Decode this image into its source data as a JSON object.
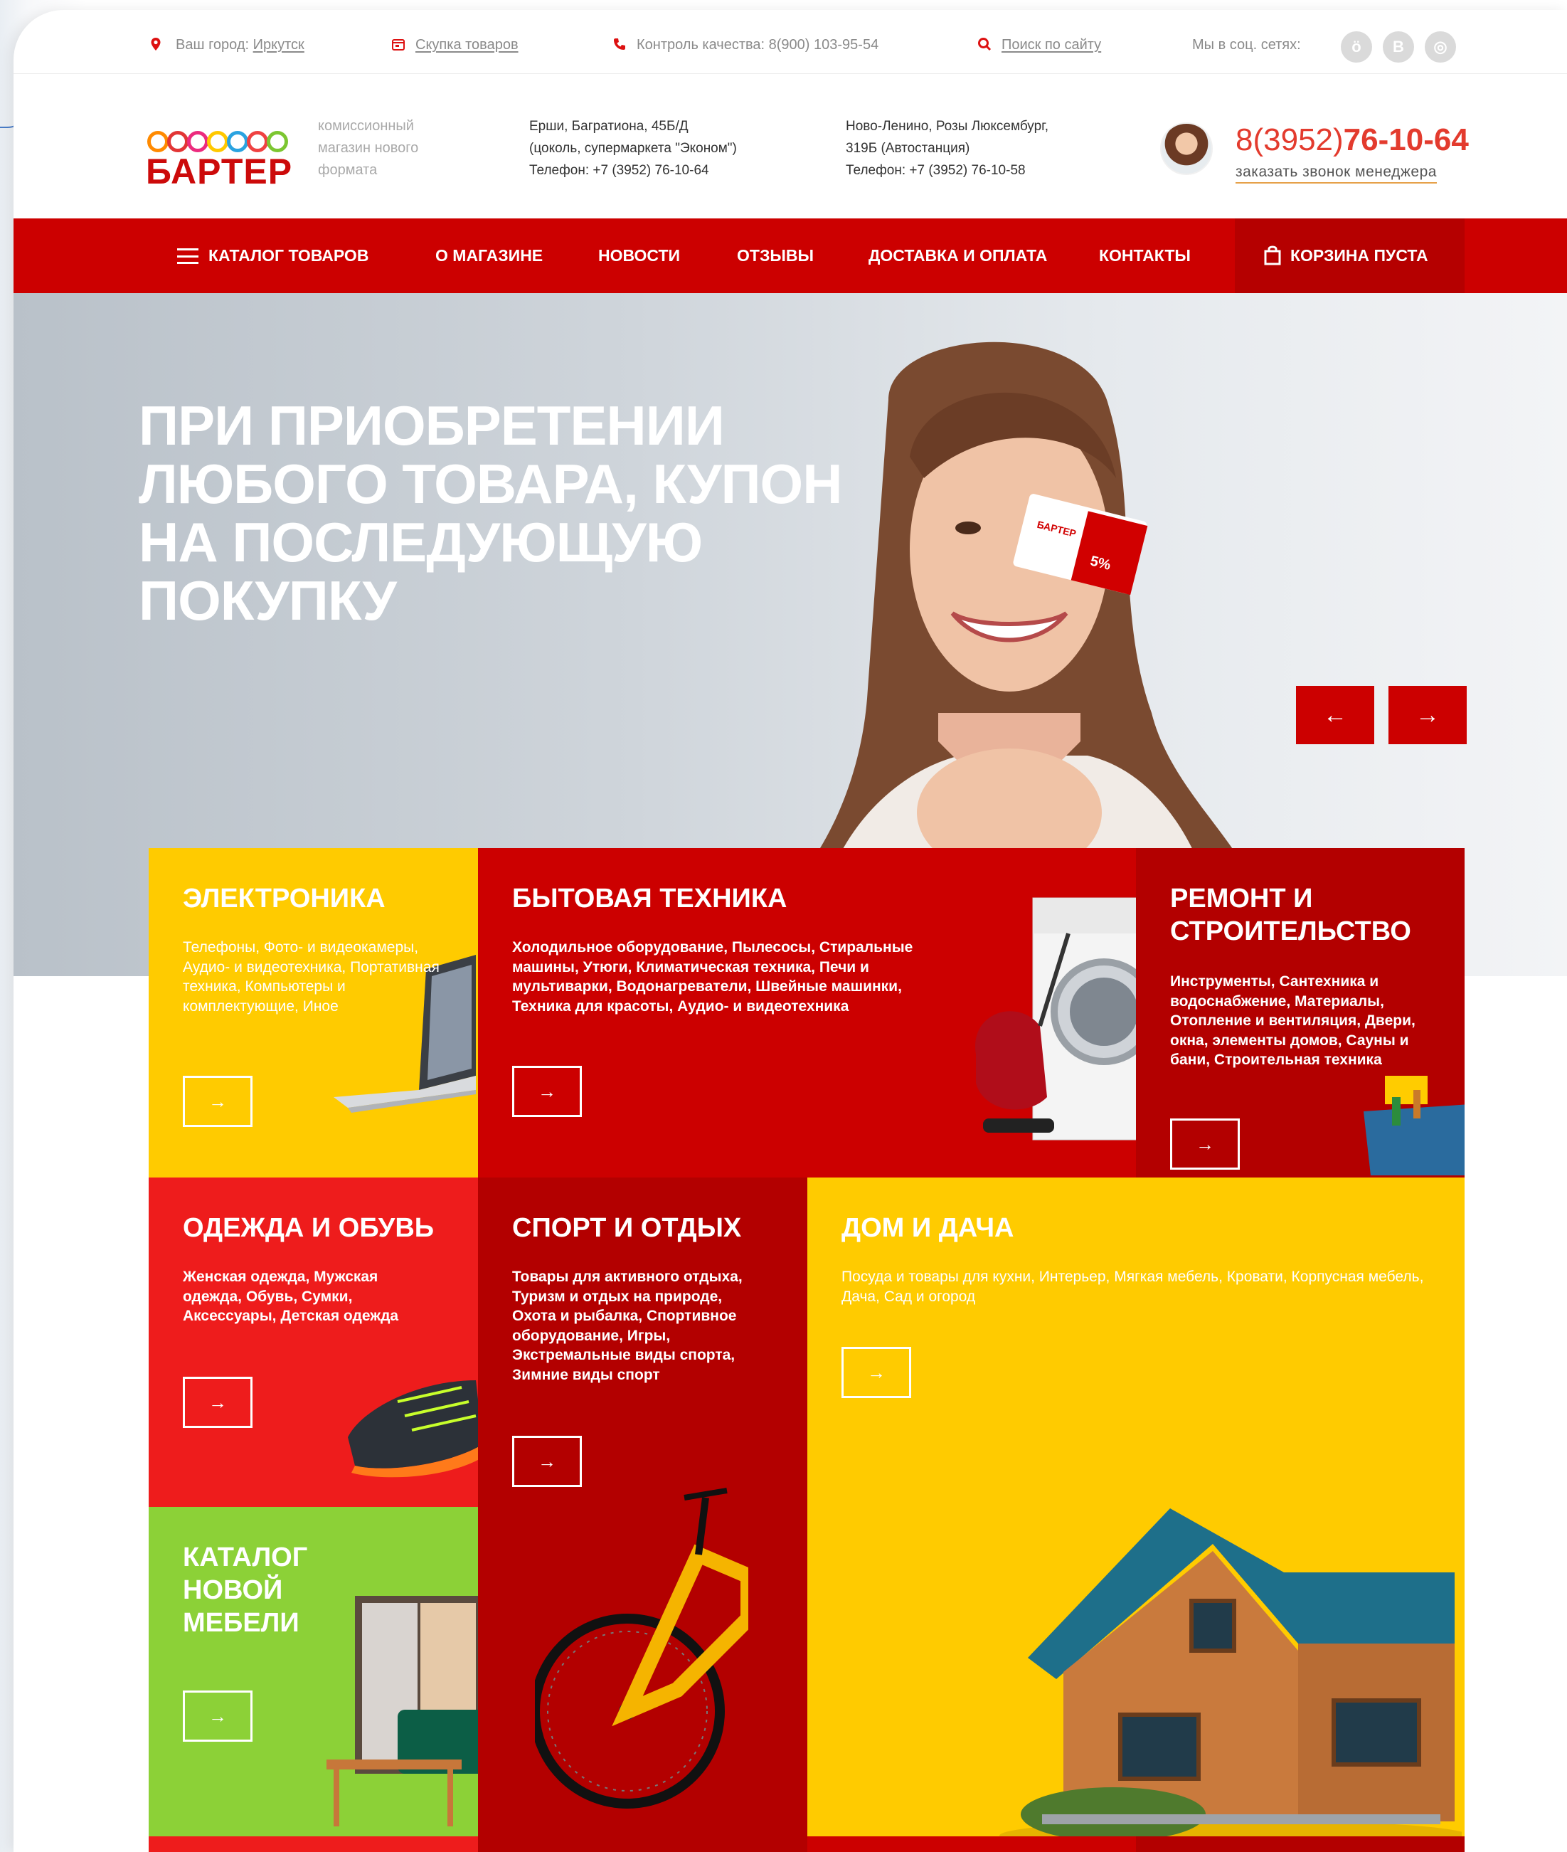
{
  "topbar": {
    "city_label": "Ваш город:",
    "city_value": "Иркутск",
    "buyout_link": "Скупка товаров",
    "quality_control": "Контроль качества: 8(900) 103-95-54",
    "search_link": "Поиск по сайту",
    "social_label": "Мы в соц. сетях:",
    "social_icons": [
      "odnoklassniki-icon",
      "vkontakte-icon",
      "instagram-icon"
    ],
    "social_glyphs": [
      "ö",
      "В",
      "◎"
    ]
  },
  "header": {
    "logo_text": "БАРТЕР",
    "tagline": "комиссионный магазин нового формата",
    "address1": "Ерши, Багратиона, 45Б/Д\n(цоколь, супермаркета \"Эконом\")\nТелефон: +7 (3952) 76-10-64",
    "address2": "Ново-Ленино, Розы Люксембург,\n319Б (Автостанция)\nТелефон: +7 (3952) 76-10-58",
    "phone_prefix": "8(3952)",
    "phone_main": "76-10-64",
    "callback_link": "заказать звонок менеджера"
  },
  "nav": {
    "catalog": "КАТАЛОГ ТОВАРОВ",
    "about": "О МАГАЗИНЕ",
    "news": "НОВОСТИ",
    "reviews": "ОТЗЫВЫ",
    "delivery": "ДОСТАВКА И ОПЛАТА",
    "contacts": "КОНТАКТЫ",
    "cart": "КОРЗИНА ПУСТА"
  },
  "hero": {
    "title": "ПРИ ПРИОБРЕТЕНИИ ЛЮБОГО ТОВАРА, КУПОН НА ПОСЛЕДУЮЩУЮ ПОКУПКУ",
    "card_brand": "БАРТЕР",
    "card_discount": "5%",
    "prev_arrow": "←",
    "next_arrow": "→"
  },
  "categories": {
    "electronics": {
      "title": "ЭЛЕКТРОНИКА",
      "desc": "Телефоны, Фото- и видеокамеры, Аудио- и видеотехника, Портативная техника, Компьютеры и комплектующие, Иное"
    },
    "appliances": {
      "title": "БЫТОВАЯ ТЕХНИКА",
      "desc": "Холодильное оборудование, Пылесосы, Стиральные машины, Утюги, Климатическая техника, Печи и мультиварки, Водонагреватели, Швейные машинки, Техника для красоты, Аудио- и видеотехника"
    },
    "repair": {
      "title": "РЕМОНТ И СТРОИТЕЛЬСТВО",
      "desc": "Инструменты, Сантехника и водоснабжение, Материалы, Отопление и вентиляция, Двери, окна, элементы домов, Сауны и бани, Строительная техника"
    },
    "clothes": {
      "title": "ОДЕЖДА И ОБУВЬ",
      "desc": "Женская одежда, Мужская одежда, Обувь, Сумки, Аксессуары, Детская одежда"
    },
    "sport": {
      "title": "СПОРТ И ОТДЫХ",
      "desc": "Товары для активного отдыха, Туризм и отдых на природе, Охота и рыбалка, Спортивное оборудование, Игры, Экстремальные виды спорта, Зимние виды спорт"
    },
    "home": {
      "title": "ДОМ И ДАЧА",
      "desc": "Посуда и товары для кухни, Интерьер, Мягкая мебель, Кровати, Корпусная мебель, Дача, Сад и огород"
    },
    "furniture": {
      "title": "КАТАЛОГ НОВОЙ МЕБЕЛИ"
    },
    "arrow": "→"
  },
  "colors": {
    "brand_red": "#cc0000",
    "dark_red": "#b30000",
    "yellow": "#ffcb00",
    "bright_red": "#ee1c1c",
    "green": "#8cd137"
  }
}
